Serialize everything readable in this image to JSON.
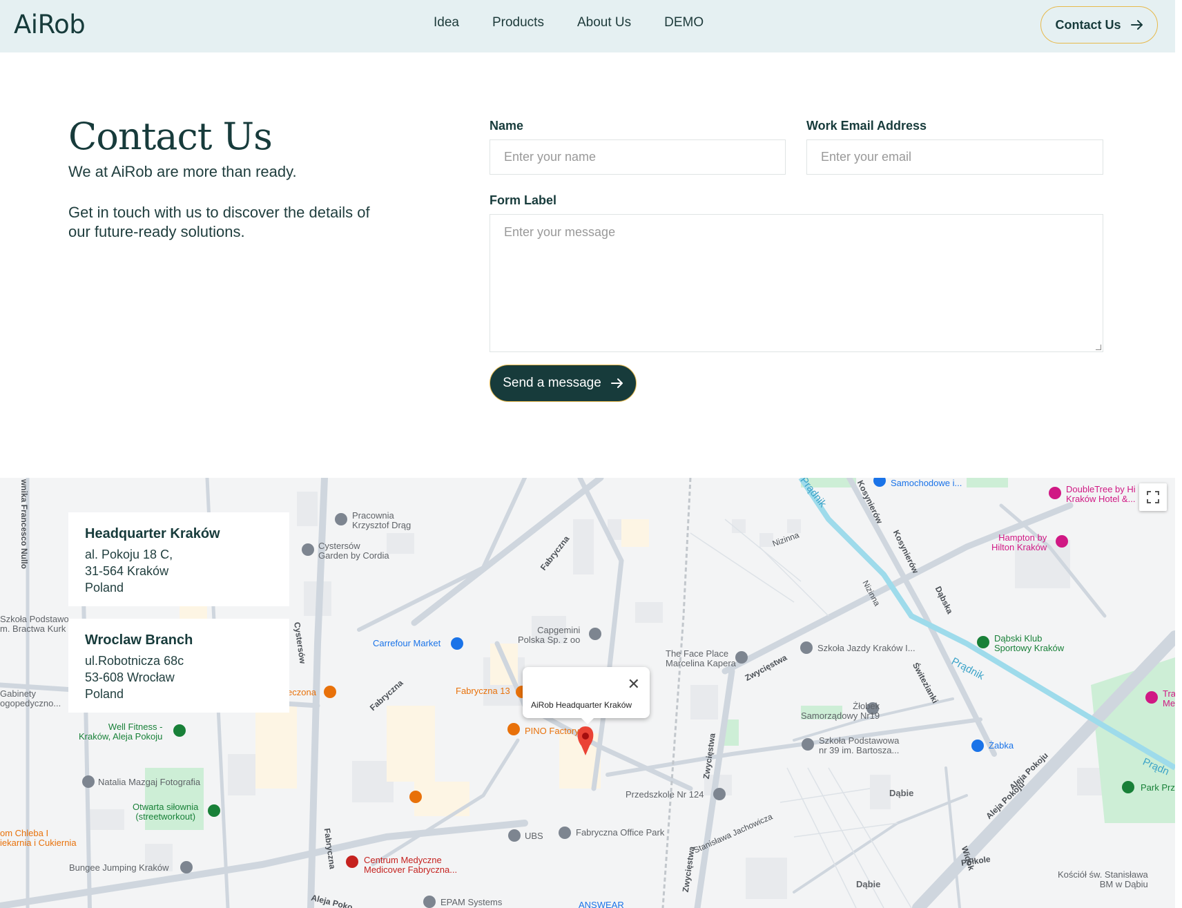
{
  "header": {
    "logo": "AiRob",
    "nav": [
      "Idea",
      "Products",
      "About Us",
      "DEMO"
    ],
    "contact_button": "Contact Us"
  },
  "contact": {
    "title": "Contact Us",
    "subtitle": "We at AiRob are more than ready.",
    "text": "Get in touch with us to discover the details of our future-ready solutions."
  },
  "form": {
    "name_label": "Name",
    "name_placeholder": "Enter your name",
    "email_label": "Work Email Address",
    "email_placeholder": "Enter your email",
    "message_label": "Form Label",
    "message_placeholder": "Enter your message",
    "submit": "Send a message"
  },
  "offices": [
    {
      "name": "Headquarter Kraków",
      "lines": [
        "al. Pokoju 18 C,",
        "31-564 Kraków",
        "Poland"
      ]
    },
    {
      "name": "Wroclaw Branch",
      "lines": [
        "ul.Robotnicza 68c",
        "53-608 Wrocław",
        "Poland"
      ]
    }
  ],
  "map": {
    "popup": "AiRob Headquarter Kraków",
    "pois": [
      {
        "text": "Pracownia\nKrzysztof Drąg",
        "color": "grey"
      },
      {
        "text": "Cystersów\nGarden by Cordia",
        "color": "grey"
      },
      {
        "text": "Capgemini\nPolska Sp. z oo",
        "color": "grey"
      },
      {
        "text": "Carrefour Market",
        "color": "blue"
      },
      {
        "text": "Fabryczna 13",
        "color": "orange"
      },
      {
        "text": "PINO Factory",
        "color": "orange"
      },
      {
        "text": "The Face Place\nMarcelina Kapera",
        "color": "grey"
      },
      {
        "text": "Szkoła Jazdy Kraków I...",
        "color": "grey"
      },
      {
        "text": "Żłobek\nSamorządowy Nr19",
        "color": "grey"
      },
      {
        "text": "Szkoła Podstawowa\nnr 39 im. Bartosza...",
        "color": "grey"
      },
      {
        "text": "Żabka",
        "color": "blue"
      },
      {
        "text": "Dąbski Klub\nSportowy Kraków",
        "color": "green"
      },
      {
        "text": "DoubleTree by Hi\nKraków Hotel &...",
        "color": "pink"
      },
      {
        "text": "Hampton by\nHilton Kraków",
        "color": "pink"
      },
      {
        "text": "Samochodowe i...",
        "color": "blue"
      },
      {
        "text": "Well Fitness -\nKraków, Aleja Pokoju",
        "color": "green"
      },
      {
        "text": "Natalia Mazgaj Fotografia",
        "color": "grey"
      },
      {
        "text": "Otwarta siłownia\n(streetworkout)",
        "color": "green"
      },
      {
        "text": "Bungee Jumping Kraków",
        "color": "grey"
      },
      {
        "text": "Centrum Medyczne\nMedicover Fabryczna...",
        "color": "red"
      },
      {
        "text": "UBS",
        "color": "grey"
      },
      {
        "text": "Fabryczna Office Park",
        "color": "grey"
      },
      {
        "text": "Przedszkole Nr 124",
        "color": "grey"
      },
      {
        "text": "Dąbie",
        "color": "grey"
      },
      {
        "text": "Park Prz",
        "color": "green"
      },
      {
        "text": "Kościół św. Stanisława\nBM w Dąbiu",
        "color": "grey"
      },
      {
        "text": "EPAM Systems",
        "color": "grey"
      },
      {
        "text": "ANSWEAR",
        "color": "blue"
      },
      {
        "text": "Dąbie",
        "color": "grey"
      },
      {
        "text": "Szkoła Podstawo\nm. Bractwa Kurk",
        "color": "grey"
      },
      {
        "text": "Gabinety\nogopedyczno...",
        "color": "grey"
      },
      {
        "text": "om Chleba I\niekarnia i Cukiernia",
        "color": "orange"
      },
      {
        "text": "eczona",
        "color": "orange"
      },
      {
        "text": "Tra\nMe",
        "color": "pink"
      }
    ],
    "streets": [
      "Fabryczna",
      "Fabryczna",
      "Fabryczna",
      "Cystersów",
      "Zwycięstwa",
      "Zwycięstwa",
      "Zwycięstwa",
      "Nizinna",
      "Nizinna",
      "Kosynierów",
      "Kosynierów",
      "Dąbska",
      "Świtezianki",
      "Aleja Pokoju",
      "Aleja Pokoju",
      "Aleja Poko",
      "Stanisława Jachowicza",
      "Widok",
      "Półkole",
      "wnika Francesco Nullo"
    ],
    "rivers": [
      "Prądnik",
      "Prądnik",
      "Prądn"
    ]
  }
}
